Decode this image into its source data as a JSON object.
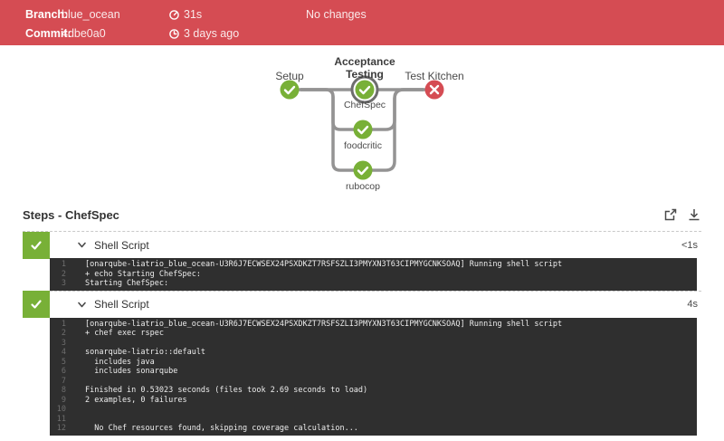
{
  "banner": {
    "branch_label": "Branch:",
    "branch_value": "blue_ocean",
    "commit_label": "Commit:",
    "commit_value": "4dbe0a0",
    "duration": "31s",
    "time_ago": "3 days ago",
    "changes_text": "No changes"
  },
  "pipeline": {
    "nodes": {
      "setup": {
        "label": "Setup",
        "status": "success"
      },
      "acceptance": {
        "label": "Acceptance Testing",
        "status": "success",
        "selected": true
      },
      "chefspec": {
        "label": "ChefSpec",
        "status": "success"
      },
      "foodcritic": {
        "label": "foodcritic",
        "status": "success"
      },
      "rubocop": {
        "label": "rubocop",
        "status": "success"
      },
      "test_kitchen": {
        "label": "Test Kitchen",
        "status": "failure"
      }
    }
  },
  "steps": {
    "title": "Steps - ChefSpec",
    "items": [
      {
        "label": "Shell Script",
        "duration": "<1s",
        "status": "success",
        "log_lines": [
          "[onarqube-liatrio_blue_ocean-U3R6J7ECWSEX24PSXDKZT7RSFSZLI3PMYXN3T63CIPMYGCNKSOAQ] Running shell script",
          "+ echo Starting ChefSpec:",
          "Starting ChefSpec:"
        ]
      },
      {
        "label": "Shell Script",
        "duration": "4s",
        "status": "success",
        "log_lines": [
          "[onarqube-liatrio_blue_ocean-U3R6J7ECWSEX24PSXDKZT7RSFSZLI3PMYXN3T63CIPMYGCNKSOAQ] Running shell script",
          "+ chef exec rspec",
          "",
          "sonarqube-liatrio::default",
          "  includes java",
          "  includes sonarqube",
          "",
          "Finished in 0.53023 seconds (files took 2.69 seconds to load)",
          "2 examples, 0 failures",
          "",
          "",
          "  No Chef resources found, skipping coverage calculation..."
        ]
      }
    ]
  },
  "colors": {
    "banner_bg": "#d54c53",
    "success_green": "#78b037",
    "failure_red": "#d54c53",
    "edge_gray": "#949393",
    "selected_ring": "#6e6e6e",
    "console_bg": "#2f2f2f"
  }
}
